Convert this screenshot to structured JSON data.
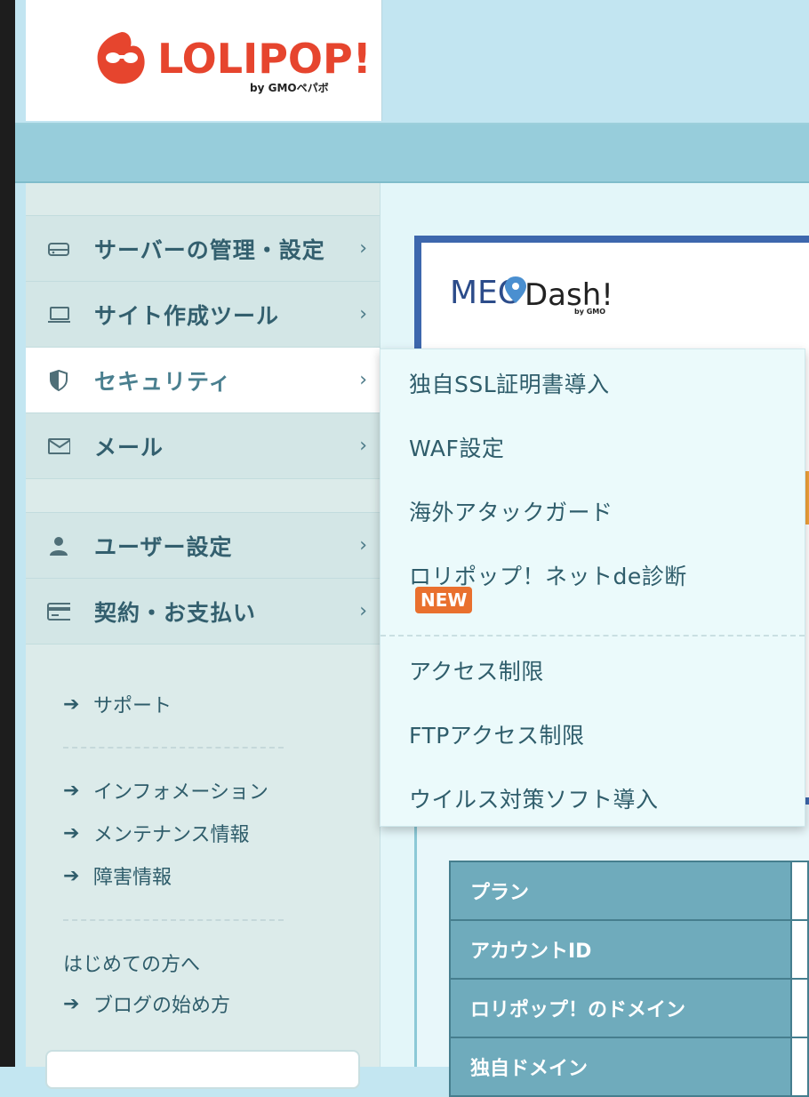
{
  "brand": {
    "logo_text": "LOLIPOP!",
    "logo_sub": "by GMOペパボ",
    "logo_color": "#e6452e"
  },
  "sidebar": {
    "items": [
      {
        "label": "サーバーの管理・設定",
        "icon": "server-icon"
      },
      {
        "label": "サイト作成ツール",
        "icon": "laptop-icon"
      },
      {
        "label": "セキュリティ",
        "icon": "shield-icon"
      },
      {
        "label": "メール",
        "icon": "envelope-icon"
      },
      {
        "label": "ユーザー設定",
        "icon": "user-icon"
      },
      {
        "label": "契約・お支払い",
        "icon": "credit-card-icon"
      }
    ],
    "chevron": "›",
    "arrow": "➔",
    "links": {
      "support": "サポート",
      "information": "インフォメーション",
      "maintenance": "メンテナンス情報",
      "incident": "障害情報",
      "beginners_heading": "はじめての方へ",
      "blog_guide": "ブログの始め方"
    }
  },
  "banner": {
    "meo_text": "MEO",
    "dash_text": "Dash!",
    "by_text": "by GMO",
    "brand_color": "#3d67ad"
  },
  "dropdown": {
    "items": [
      "独自SSL証明書導入",
      "WAF設定",
      "海外アタックガード",
      "ロリポップ！ネットde診断",
      "アクセス制限",
      "FTPアクセス制限",
      "ウイルス対策ソフト導入"
    ],
    "badge": "NEW",
    "badge_color": "#e9702e"
  },
  "account_table": {
    "rows": [
      "プラン",
      "アカウントID",
      "ロリポップ！のドメイン",
      "独自ドメイン"
    ]
  }
}
